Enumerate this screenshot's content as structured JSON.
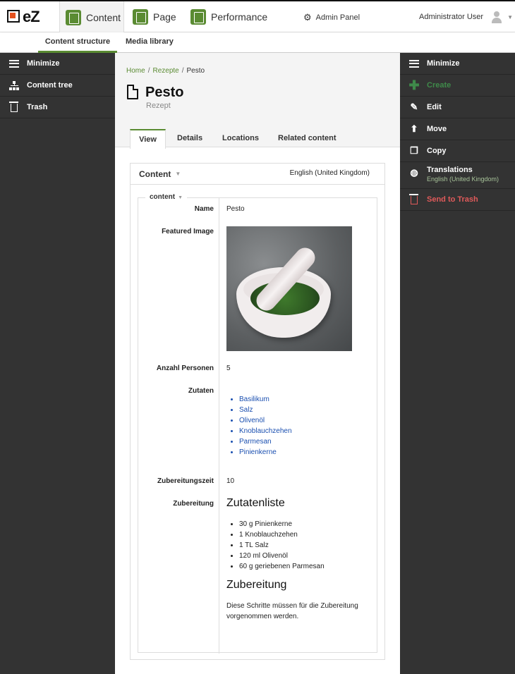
{
  "app": {
    "logo_text": "eZ",
    "tabs": [
      {
        "label": "Content",
        "icon": "content-icon"
      },
      {
        "label": "Page",
        "icon": "page-icon"
      },
      {
        "label": "Performance",
        "icon": "performance-icon"
      }
    ],
    "admin_panel_label": "Admin Panel",
    "user_label": "Administrator User"
  },
  "subnav": {
    "items": [
      "Content structure",
      "Media library"
    ],
    "accent_color": "#5a8b32"
  },
  "left_panel": {
    "items": [
      {
        "label": "Minimize",
        "icon": "hamburger-icon"
      },
      {
        "label": "Content tree",
        "icon": "tree-icon"
      },
      {
        "label": "Trash",
        "icon": "trash-icon"
      }
    ]
  },
  "right_panel": {
    "items": [
      {
        "label": "Minimize",
        "icon": "hamburger-icon"
      },
      {
        "label": "Create",
        "icon": "plus-icon",
        "disabled": true
      },
      {
        "label": "Edit",
        "icon": "pencil-icon"
      },
      {
        "label": "Move",
        "icon": "move-icon"
      },
      {
        "label": "Copy",
        "icon": "copy-icon"
      },
      {
        "label": "Translations",
        "icon": "globe-icon",
        "sub": "English (United Kingdom)"
      },
      {
        "label": "Send to Trash",
        "icon": "trash-icon",
        "danger": true
      }
    ]
  },
  "breadcrumb": {
    "items": [
      "Home",
      "Rezepte",
      "Pesto"
    ]
  },
  "page": {
    "title": "Pesto",
    "subtitle": "Rezept"
  },
  "content_tabs": [
    "View",
    "Details",
    "Locations",
    "Related content"
  ],
  "content_box": {
    "title": "Content",
    "language": "English (United Kingdom)",
    "group_label": "content"
  },
  "fields": {
    "name": {
      "label": "Name",
      "value": "Pesto"
    },
    "featured_image": {
      "label": "Featured Image"
    },
    "persons": {
      "label": "Anzahl Personen",
      "value": "5"
    },
    "ingredients": {
      "label": "Zutaten",
      "items": [
        "Basilikum",
        "Salz",
        "Olivenöl",
        "Knoblauchzehen",
        "Parmesan",
        "Pinienkerne"
      ]
    },
    "prep_time": {
      "label": "Zubereitungszeit",
      "value": "10"
    },
    "preparation": {
      "label": "Zubereitung",
      "heading1": "Zutatenliste",
      "list": [
        "30 g Pinienkerne",
        "1 Knoblauchzehen",
        "1 TL Salz",
        "120 ml Olivenöl",
        "60 g geriebenen Parmesan"
      ],
      "heading2": "Zubereitung",
      "text": "Diese Schritte müssen für die Zubereitung vorgenommen werden."
    }
  }
}
